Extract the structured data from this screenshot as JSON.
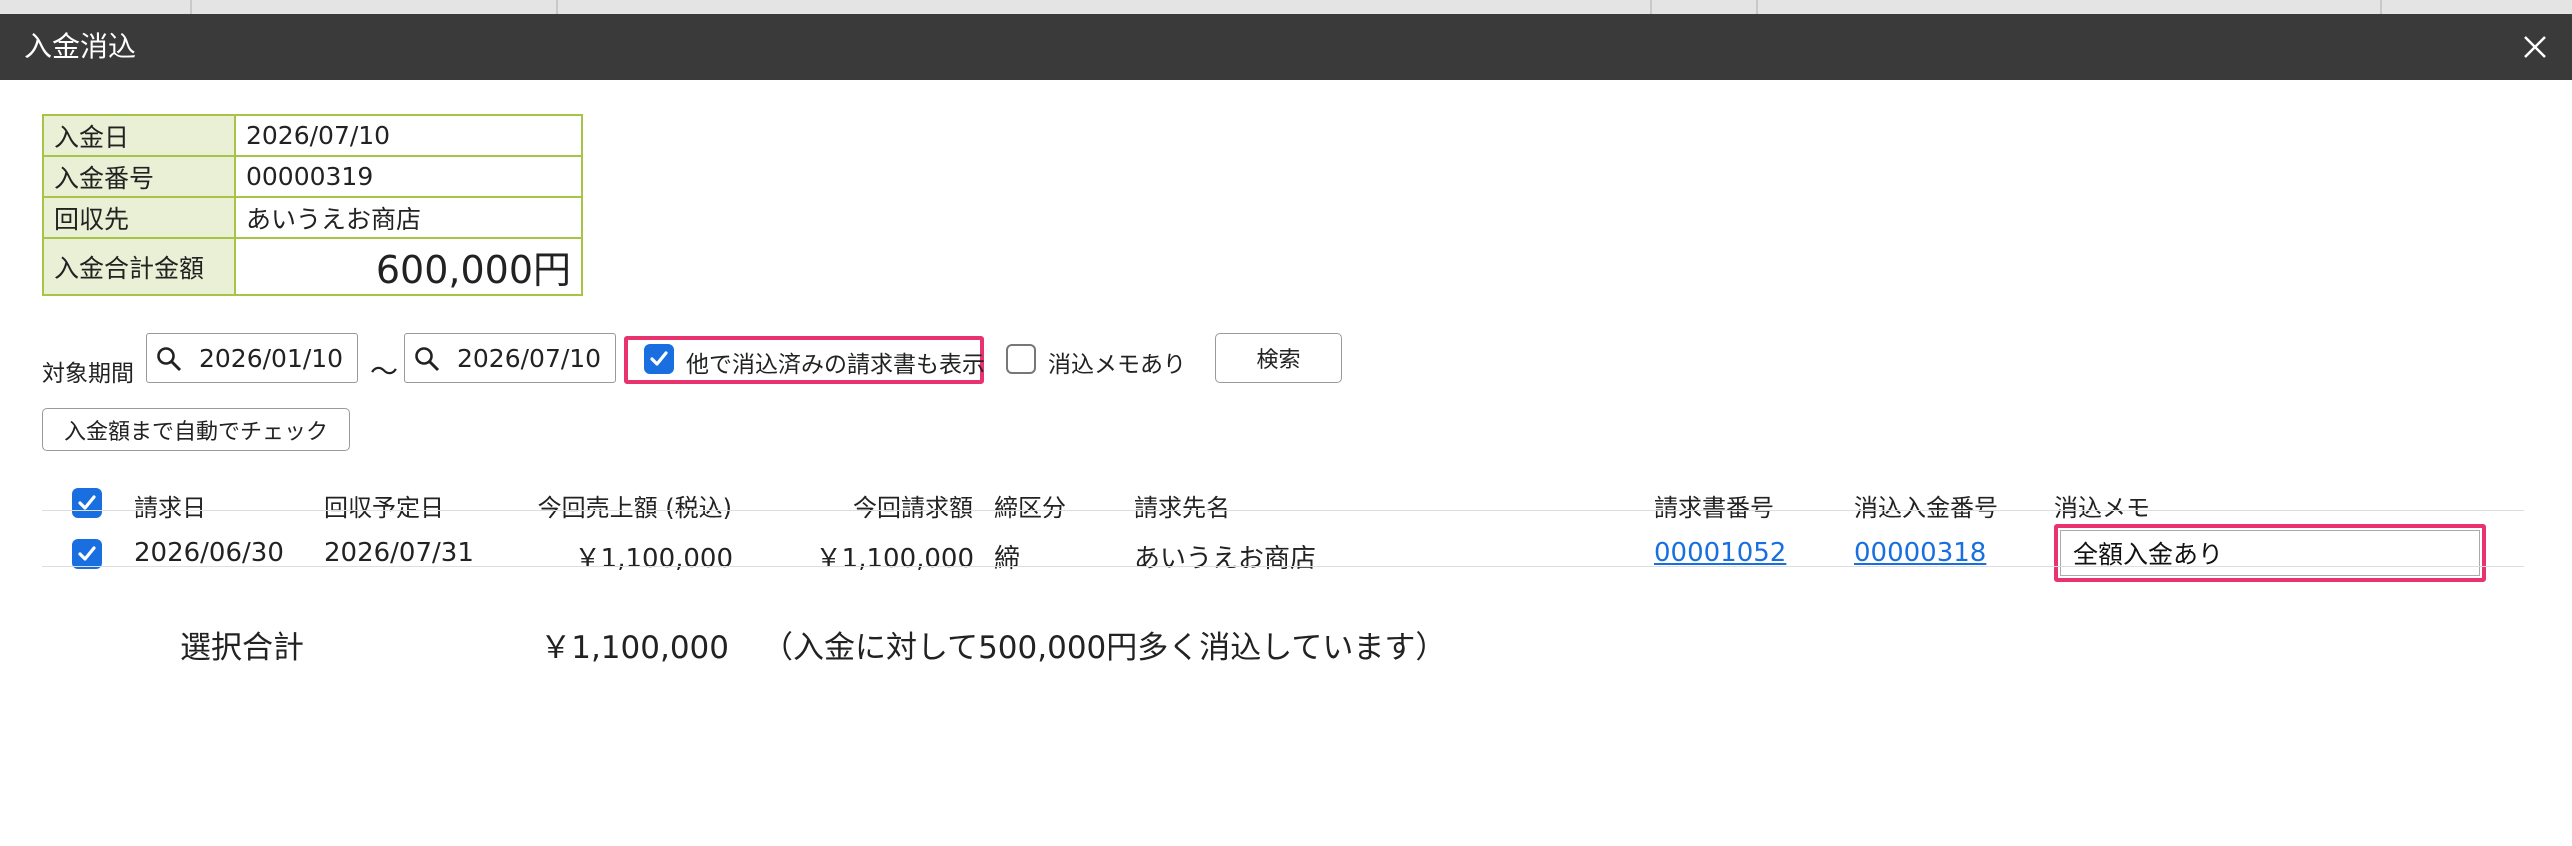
{
  "dialog": {
    "title": "入金消込"
  },
  "payment_info": {
    "rows": [
      {
        "label": "入金日",
        "value": "2026/07/10"
      },
      {
        "label": "入金番号",
        "value": "00000319"
      },
      {
        "label": "回収先",
        "value": "あいうえお商店"
      },
      {
        "label": "入金合計金額",
        "value": "600,000円"
      }
    ]
  },
  "filter": {
    "period_label": "対象期間",
    "date_from": "2026/01/10",
    "separator": "〜",
    "date_to": "2026/07/10",
    "show_cleared_label": "他で消込済みの請求書も表示",
    "show_cleared_checked": true,
    "memo_only_label": "消込メモあり",
    "memo_only_checked": false,
    "search_label": "検索"
  },
  "auto_check_label": "入金額まで自動でチェック",
  "table": {
    "headers": {
      "invoice_date": "請求日",
      "due_date": "回収予定日",
      "sales_amount": "今回売上額 (税込)",
      "billing_amount": "今回請求額",
      "closing_type": "締区分",
      "customer": "請求先名",
      "invoice_no": "請求書番号",
      "payment_no": "消込入金番号",
      "memo": "消込メモ"
    },
    "rows": [
      {
        "checked": true,
        "invoice_date": "2026/06/30",
        "due_date": "2026/07/31",
        "sales_amount": "￥1,100,000",
        "billing_amount": "￥1,100,000",
        "closing_type": "締",
        "customer": "あいうえお商店",
        "invoice_no": "00001052",
        "payment_no": "00000318",
        "memo": "全額入金あり"
      }
    ]
  },
  "summary": {
    "label": "選択合計",
    "amount": "￥1,100,000",
    "note": "（入金に対して500,000円多く消込しています）"
  },
  "colors": {
    "highlight": "#e8336e",
    "checkbox": "#1a6fe0",
    "link": "#1a6fe0",
    "info_border": "#a8c448",
    "info_key_bg": "#e9f0d5",
    "titlebar": "#3a3a3a"
  }
}
